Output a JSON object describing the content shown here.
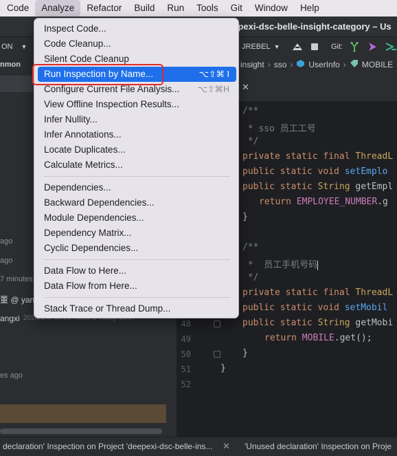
{
  "menubar": {
    "items": [
      "Code",
      "Analyze",
      "Refactor",
      "Build",
      "Run",
      "Tools",
      "Git",
      "Window",
      "Help"
    ],
    "active": "Analyze"
  },
  "window": {
    "title": "eepexi-dsc-belle-insight-category – Us"
  },
  "toolbar": {
    "run_config": "ON",
    "jrebel_label": "JREBEL",
    "git_label": "Git:"
  },
  "breadcrumb": [
    "insight",
    "sso",
    "UserInfo",
    "MOBILE"
  ],
  "left_panel": {
    "project_label": "nmon",
    "entries": [
      "ago",
      "ago",
      "7 minutes",
      "董 @ yang",
      "angxi",
      "es ago"
    ],
    "faded_detail": "2024/1/4, 14:26, 5330 B Today 14:07"
  },
  "editor": {
    "line_numbers": [
      "48",
      "49",
      "50",
      "51",
      "52"
    ],
    "code": {
      "c1": "/**",
      "c2": " * sso 员工工号",
      "c3": " */",
      "l1_kw": "private static final ",
      "l1_ty": "ThreadL",
      "l2_kw": "public static void ",
      "l2_fn": "setEmplo",
      "l3_kw": "public static ",
      "l3_ty": "String ",
      "l3_fn": "getEmpl",
      "l4_kw": "return ",
      "l4_cn": "EMPLOYEE_NUMBER",
      "l4_rest": ".g",
      "brace": "}",
      "c4": "/**",
      "c5": " *  员工手机号码",
      "c6": " */",
      "l5_kw": "private static final ",
      "l5_ty": "ThreadL",
      "l6_kw": "public static void ",
      "l6_fn": "setMobil",
      "l7_kw": "public static ",
      "l7_ty": "String ",
      "l7_fn": "getMobi",
      "l8_kw": "return ",
      "l8_cn": "MOBILE",
      "l8_rest": ".get();",
      "brace2": "}",
      "brace3": "}"
    }
  },
  "statusbar": {
    "left": "declaration' Inspection on Project 'deepexi-dsc-belle-ins...",
    "right": "'Unused declaration' Inspection on Proje"
  },
  "analyze_menu": {
    "group1": [
      {
        "label": "Inspect Code..."
      },
      {
        "label": "Code Cleanup..."
      },
      {
        "label": "Silent Code Cleanup"
      },
      {
        "label": "Run Inspection by Name...",
        "shortcut": "⌥⇧⌘ I"
      },
      {
        "label": "Configure Current File Analysis...",
        "shortcut": "⌥⇧⌘H"
      },
      {
        "label": "View Offline Inspection Results..."
      },
      {
        "label": "Infer Nullity..."
      },
      {
        "label": "Infer Annotations..."
      },
      {
        "label": "Locate Duplicates..."
      },
      {
        "label": "Calculate Metrics..."
      }
    ],
    "group2": [
      {
        "label": "Dependencies..."
      },
      {
        "label": "Backward Dependencies..."
      },
      {
        "label": "Module Dependencies..."
      },
      {
        "label": "Dependency Matrix..."
      },
      {
        "label": "Cyclic Dependencies..."
      }
    ],
    "group3": [
      {
        "label": "Data Flow to Here..."
      },
      {
        "label": "Data Flow from Here..."
      }
    ],
    "group4": [
      {
        "label": "Stack Trace or Thread Dump..."
      }
    ]
  },
  "colors": {
    "highlight": "#1f6feb",
    "annotation_box": "#e02b2b",
    "menu_bg": "#e6e4ea",
    "editor_bg": "#1e1f22"
  }
}
